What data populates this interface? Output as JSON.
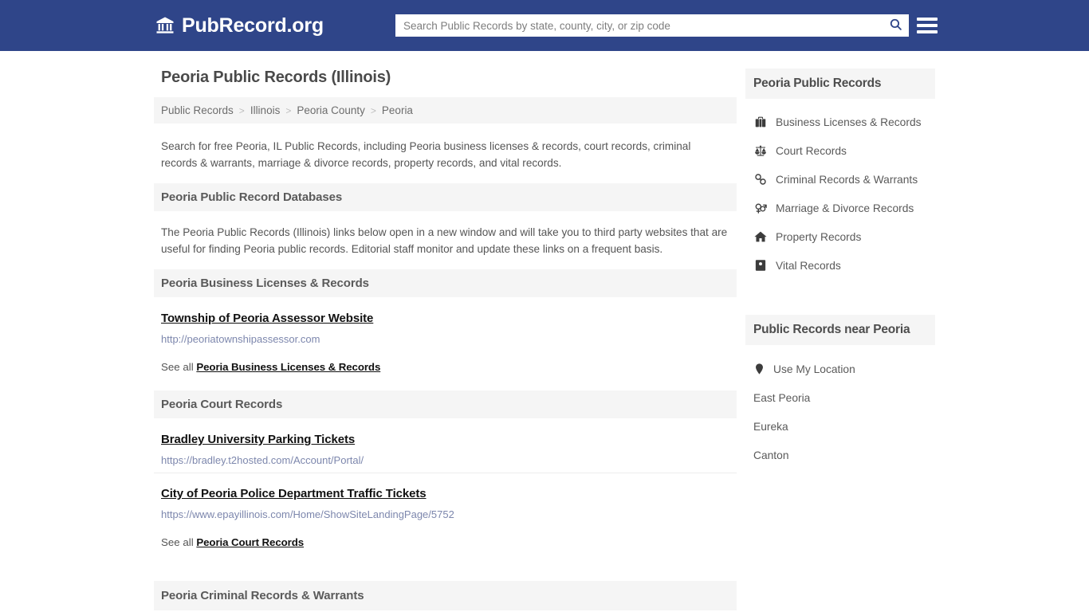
{
  "header": {
    "logo_icon": "bank-building-icon",
    "logo_text": "PubRecord.org",
    "search_placeholder": "Search Public Records by state, county, city, or zip code",
    "search_value": "",
    "search_icon": "search-icon",
    "menu_icon": "hamburger-menu-icon",
    "background_color": "#2f4589"
  },
  "page": {
    "title": "Peoria Public Records (Illinois)",
    "breadcrumb": [
      {
        "label": "Public Records"
      },
      {
        "label": "Illinois"
      },
      {
        "label": "Peoria County"
      },
      {
        "label": "Peoria"
      }
    ],
    "breadcrumb_separator": ">",
    "intro": "Search for free Peoria, IL Public Records, including Peoria business licenses & records, court records, criminal records & warrants, marriage & divorce records, property records, and vital records.",
    "databases_heading": "Peoria Public Record Databases",
    "databases_text": "The Peoria Public Records (Illinois) links below open in a new window and will take you to third party websites that are useful for finding Peoria public records. Editorial staff monitor and update these links on a frequent basis.",
    "sections": [
      {
        "heading": "Peoria Business Licenses & Records",
        "entries": [
          {
            "title": "Township of Peoria Assessor Website",
            "url": "http://peoriatownshipassessor.com"
          }
        ],
        "see_all_prefix": "See all ",
        "see_all_link": "Peoria Business Licenses & Records"
      },
      {
        "heading": "Peoria Court Records",
        "entries": [
          {
            "title": "Bradley University Parking Tickets",
            "url": "https://bradley.t2hosted.com/Account/Portal/"
          },
          {
            "title": "City of Peoria Police Department Traffic Tickets",
            "url": "https://www.epayillinois.com/Home/ShowSiteLandingPage/5752"
          }
        ],
        "see_all_prefix": "See all ",
        "see_all_link": "Peoria Court Records"
      },
      {
        "heading": "Peoria Criminal Records & Warrants",
        "entries": [],
        "see_all_prefix": "",
        "see_all_link": ""
      }
    ]
  },
  "sidebar": {
    "records_heading": "Peoria Public Records",
    "records_items": [
      {
        "icon": "briefcase-icon",
        "label": "Business Licenses & Records"
      },
      {
        "icon": "scales-balance-icon",
        "label": "Court Records"
      },
      {
        "icon": "handcuffs-icon",
        "label": "Criminal Records & Warrants"
      },
      {
        "icon": "venus-mars-icon",
        "label": "Marriage & Divorce Records"
      },
      {
        "icon": "home-icon",
        "label": "Property Records"
      },
      {
        "icon": "id-card-icon",
        "label": "Vital Records"
      }
    ],
    "near_heading": "Public Records near Peoria",
    "near_items": [
      {
        "icon": "map-pin-icon",
        "label": "Use My Location"
      },
      {
        "icon": "",
        "label": "East Peoria"
      },
      {
        "icon": "",
        "label": "Eureka"
      },
      {
        "icon": "",
        "label": "Canton"
      }
    ]
  }
}
